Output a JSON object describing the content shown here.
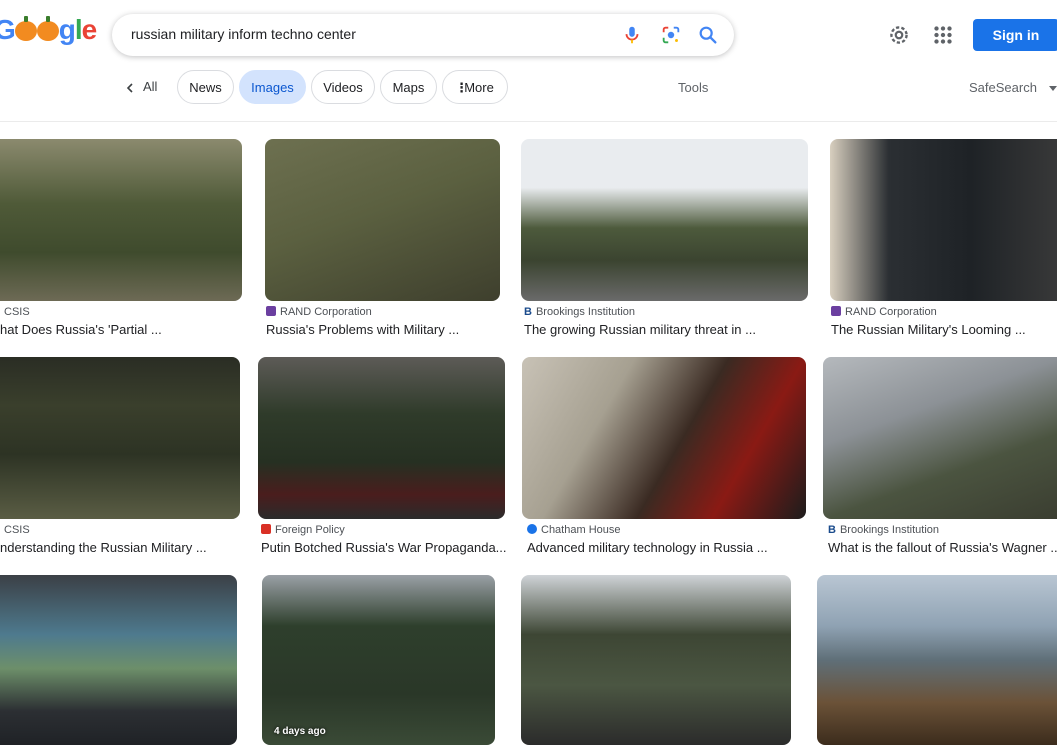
{
  "logo_text": "Google",
  "search": {
    "query": "russian military inform techno center"
  },
  "tabs": {
    "all": "All",
    "chips": [
      "News",
      "Images",
      "Videos",
      "Maps",
      "More"
    ],
    "tools": "Tools",
    "safesearch": "SafeSearch"
  },
  "header": {
    "signin": "Sign in"
  },
  "results": [
    {
      "source": "CSIS",
      "title": "hat Does Russia's 'Partial ..."
    },
    {
      "source": "RAND Corporation",
      "title": "Russia's Problems with Military ..."
    },
    {
      "source": "Brookings Institution",
      "title": "The growing Russian military threat in ..."
    },
    {
      "source": "RAND Corporation",
      "title": "The Russian Military's Looming ..."
    },
    {
      "source": "CSIS",
      "title": "nderstanding the Russian Military ..."
    },
    {
      "source": "Foreign Policy",
      "title": "Putin Botched Russia's War Propaganda..."
    },
    {
      "source": "Chatham House",
      "title": "Advanced military technology in Russia ..."
    },
    {
      "source": "Brookings Institution",
      "title": "What is the fallout of Russia's Wagner ..."
    },
    {
      "badge": ""
    },
    {
      "badge": "4 days ago"
    },
    {
      "badge": ""
    },
    {
      "badge": ""
    }
  ]
}
